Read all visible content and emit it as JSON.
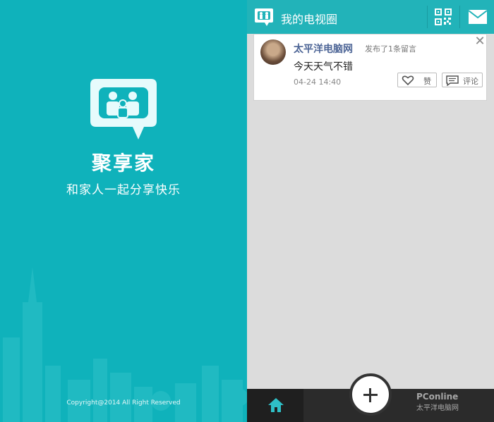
{
  "splash": {
    "app_name": "聚享家",
    "slogan": "和家人一起分享快乐",
    "copyright": "Copyright@2014 All Right Reserved"
  },
  "feed": {
    "header_title": "我的电视圈",
    "post": {
      "author": "太平洋电脑网",
      "action": "发布了1条留言",
      "content": "今天天气不错",
      "time": "04-24 14:40",
      "like_label": "赞",
      "comment_label": "评论"
    }
  },
  "watermark": {
    "brand": "PConline",
    "sub": "太平洋电脑网"
  },
  "colors": {
    "splash_bg": "#0fb2bb",
    "header_bg": "#22b3b9",
    "author": "#4d6596",
    "bottombar": "#2b2b2b"
  },
  "icons": [
    "tv-family-logo",
    "qr-code-icon",
    "mail-icon",
    "close-icon",
    "heart-icon",
    "comment-icon",
    "home-icon",
    "plus-icon"
  ]
}
